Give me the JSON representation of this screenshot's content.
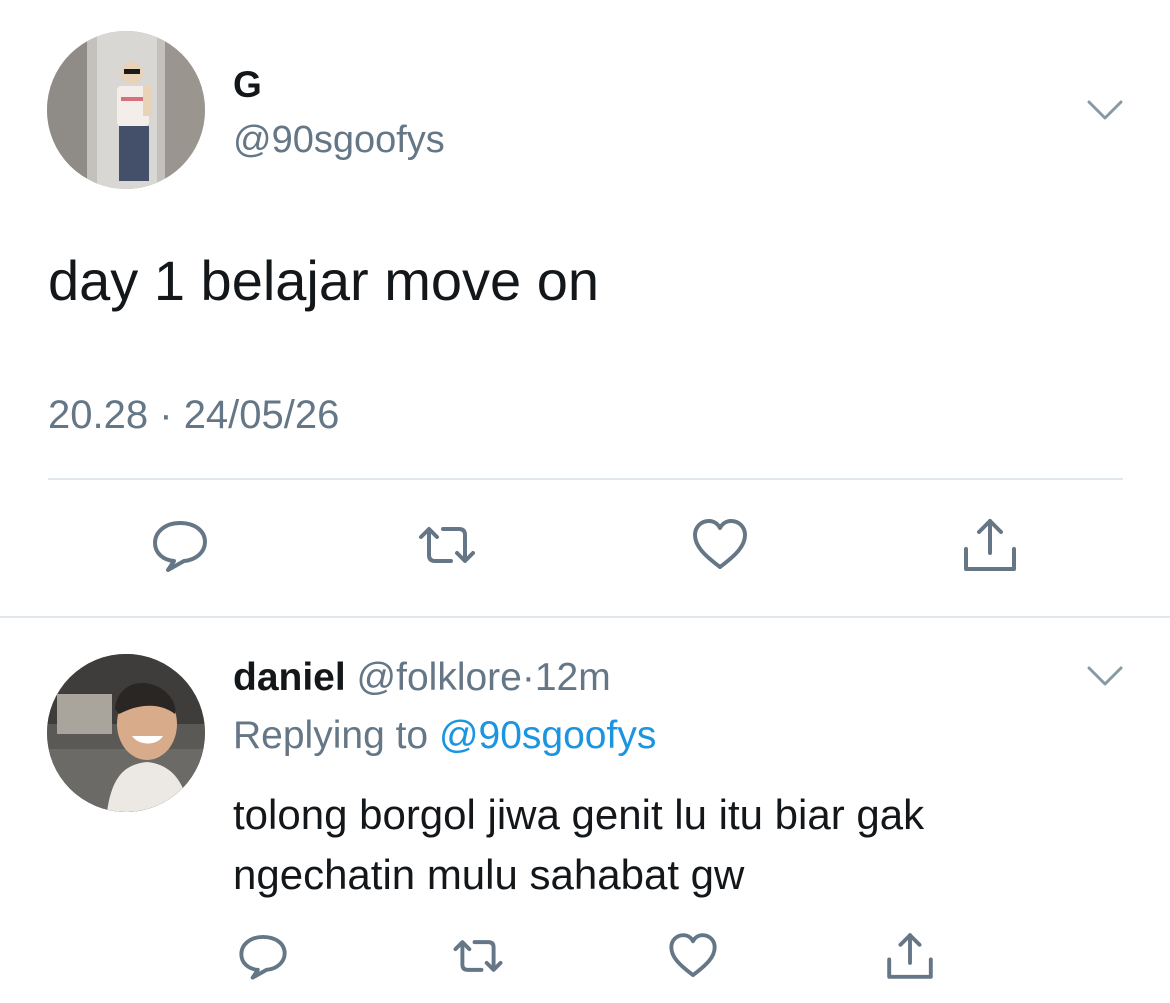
{
  "tweet": {
    "display_name": "G",
    "handle": "@90sgoofys",
    "text": "day 1 belajar move on",
    "time": "20.28",
    "separator": "·",
    "date": "24/05/26",
    "avatar_icon": "profile-photo-mirror-selfie",
    "more_icon": "chevron-down-icon"
  },
  "actions": {
    "reply_icon": "comment-icon",
    "retweet_icon": "retweet-icon",
    "like_icon": "heart-icon",
    "share_icon": "share-icon"
  },
  "reply": {
    "display_name": "daniel",
    "handle": "@folklore",
    "separator": "·",
    "time": "12m",
    "replying_prefix": "Replying to ",
    "replying_to": "@90sgoofys",
    "text_line1": "tolong borgol jiwa genit lu itu biar gak",
    "text_line2": "ngechatin mulu sahabat gw",
    "avatar_icon": "profile-photo-smiling",
    "more_icon": "chevron-down-icon"
  },
  "colors": {
    "text": "#14171a",
    "secondary": "#657786",
    "link": "#1b95e0",
    "divider": "#e1e8ed"
  }
}
